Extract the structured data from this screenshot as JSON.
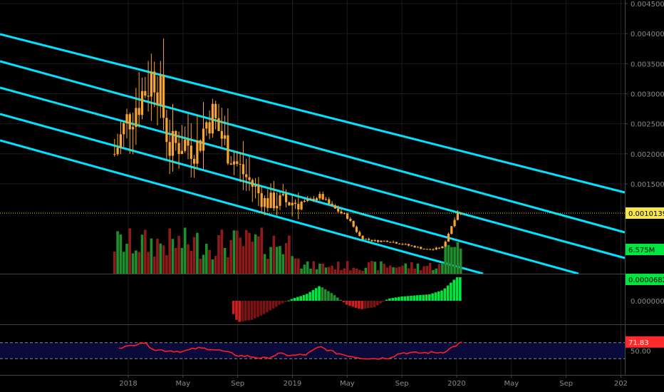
{
  "colors": {
    "background": "#000000",
    "grid": "#1c1c1c",
    "separator": "#444444",
    "axis_text": "#8a8a8a",
    "candle": "#f7a531",
    "channel": "#00e5ff",
    "last_price_line": "#f0c419",
    "last_price_tag_bg": "#f7e64a",
    "vol_up": "#1f8f2e",
    "vol_down": "#8f1a1a",
    "vol_tag_bg": "#00e640",
    "macd_up": "#00e640",
    "macd_up_weak": "#1f8f2e",
    "macd_down": "#cc1f1f",
    "macd_down_weak": "#7a1414",
    "rsi_line": "#ff1f1f",
    "rsi_band": "#0a0a3c",
    "rsi_tag_bg": "#ff2a2a"
  },
  "chart_data": [
    {
      "type": "candlestick",
      "title": "",
      "ylim": [
        0.0,
        0.0045
      ],
      "y_ticks": [
        "0.0045000",
        "0.0040000",
        "0.0035000",
        "0.0030000",
        "0.0025000",
        "0.0020000",
        "0.0015000"
      ],
      "last_price": "0.0010139",
      "last_price_value": 0.0010139,
      "x_labels": [
        "2018",
        "May",
        "Sep",
        "2019",
        "May",
        "Sep",
        "2020",
        "May",
        "Sep",
        "202"
      ],
      "x_label_dates": [
        "2018-01",
        "2018-05",
        "2018-09",
        "2019-01",
        "2019-05",
        "2019-09",
        "2020-01",
        "2020-05",
        "2020-09",
        "2021-01"
      ],
      "series_close_approx": [
        [
          "2017-12",
          0.002
        ],
        [
          "2018-01",
          0.0026
        ],
        [
          "2018-02",
          0.003
        ],
        [
          "2018-03",
          0.0034
        ],
        [
          "2018-04",
          0.0021
        ],
        [
          "2018-05",
          0.0022
        ],
        [
          "2018-06",
          0.0021
        ],
        [
          "2018-07",
          0.0027
        ],
        [
          "2018-08",
          0.0022
        ],
        [
          "2018-09",
          0.0018
        ],
        [
          "2018-10",
          0.0015
        ],
        [
          "2018-11",
          0.0012
        ],
        [
          "2018-12",
          0.0012
        ],
        [
          "2019-01",
          0.0012
        ],
        [
          "2019-02",
          0.0012
        ],
        [
          "2019-03",
          0.0013
        ],
        [
          "2019-04",
          0.0011
        ],
        [
          "2019-05",
          0.00095
        ],
        [
          "2019-06",
          0.0006
        ],
        [
          "2019-07",
          0.00055
        ],
        [
          "2019-08",
          0.00055
        ],
        [
          "2019-09",
          0.0005
        ],
        [
          "2019-10",
          0.00045
        ],
        [
          "2019-11",
          0.0004
        ],
        [
          "2019-12",
          0.00045
        ],
        [
          "2020-01",
          0.0010139
        ]
      ],
      "channel_lines": 5,
      "volume": {
        "last_label": "6.575M"
      }
    },
    {
      "type": "bar",
      "name": "MACD histogram",
      "last_label": "0.0000682",
      "zero_label": "0.0000000"
    },
    {
      "type": "line",
      "name": "RSI",
      "last_label": "71.83",
      "mid_label": "50.00",
      "upper_band": 70,
      "lower_band": 30
    }
  ]
}
